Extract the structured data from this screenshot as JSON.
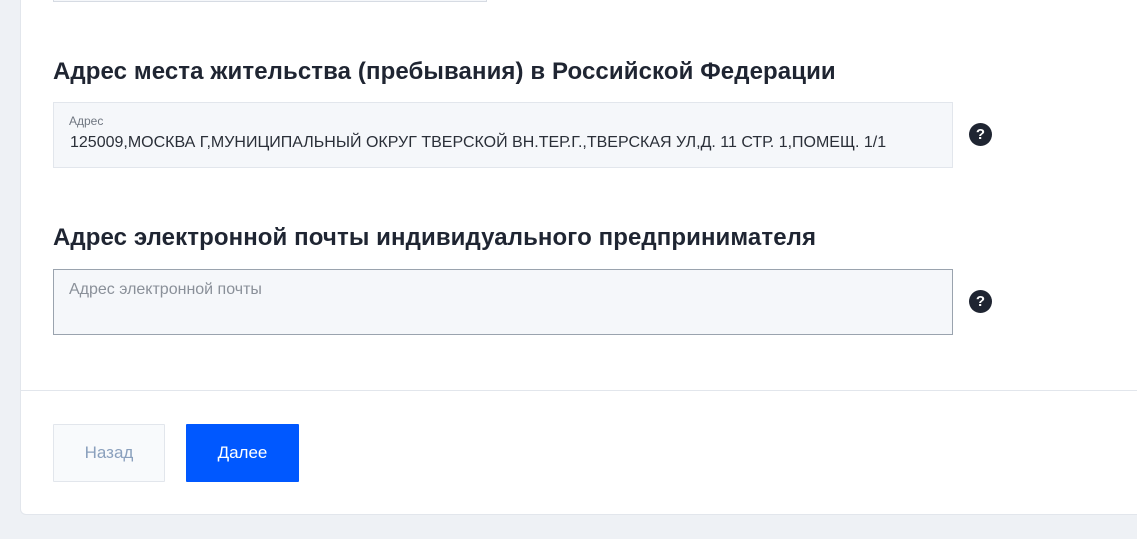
{
  "residence": {
    "title": "Адрес места жительства (пребывания) в Российской Федерации",
    "field_label": "Адрес",
    "field_value": "125009,МОСКВА Г,МУНИЦИПАЛЬНЫЙ ОКРУГ ТВЕРСКОЙ ВН.ТЕР.Г.,ТВЕРСКАЯ УЛ,Д. 11 СТР. 1,ПОМЕЩ. 1/1",
    "help_glyph": "?"
  },
  "email": {
    "title": "Адрес электронной почты индивидуального предпринимателя",
    "placeholder": "Адрес электронной почты",
    "value": "",
    "help_glyph": "?"
  },
  "buttons": {
    "back_label": "Назад",
    "next_label": "Далее"
  },
  "icons": {
    "help": "question-circle-icon"
  },
  "colors": {
    "primary": "#0058ff",
    "title_text": "#1f2532",
    "field_bg": "#f5f7fa",
    "page_bg": "#eef1f5"
  }
}
